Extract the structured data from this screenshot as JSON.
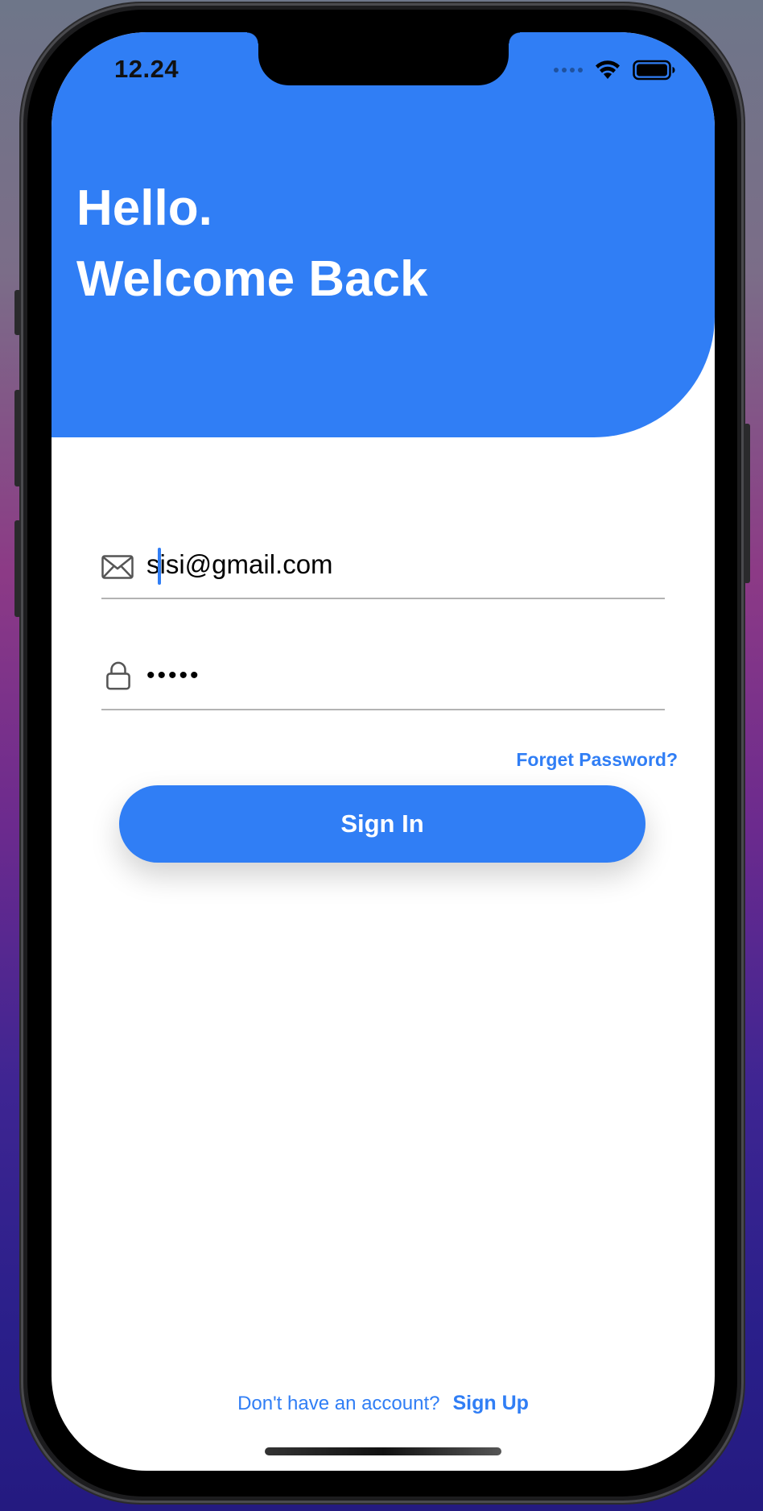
{
  "status_bar": {
    "time": "12.24",
    "icons": [
      "cellular-signal-icon",
      "wifi-icon",
      "battery-icon"
    ]
  },
  "header": {
    "line1": "Hello.",
    "line2": "Welcome Back",
    "background": "#307ef5"
  },
  "form": {
    "email": {
      "icon": "envelope-icon",
      "value": "sisi@gmail.com"
    },
    "password": {
      "icon": "lock-icon",
      "value": "•••••"
    },
    "forgot_label": "Forget Password?",
    "signin_label": "Sign In"
  },
  "footer": {
    "prompt": "Don't have an account?",
    "signup_label": "Sign Up"
  },
  "colors": {
    "accent": "#307ef5",
    "text": "#000000",
    "divider": "#b3b3b3"
  }
}
